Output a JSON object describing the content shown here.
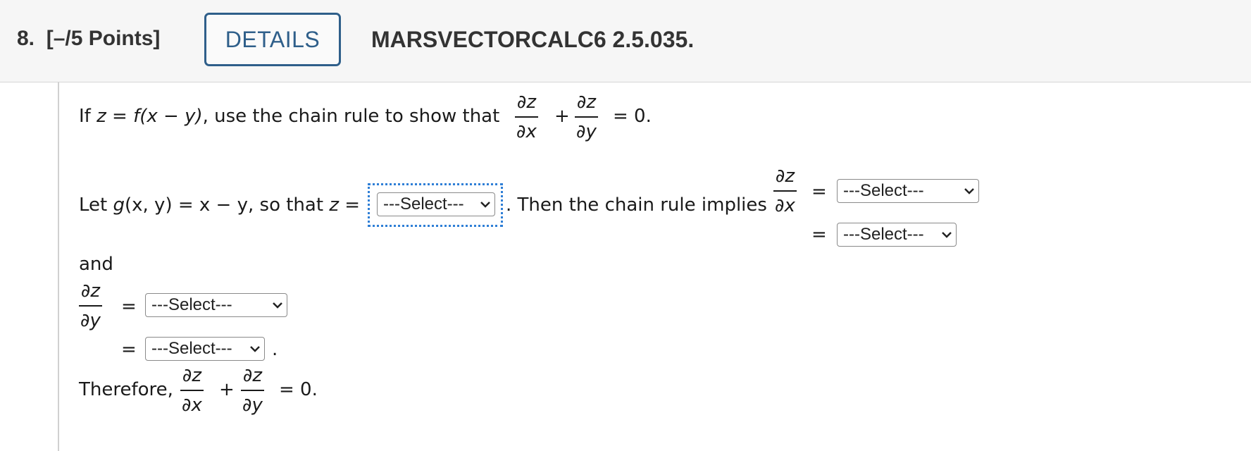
{
  "header": {
    "question_number": "8.",
    "points": "[–/5 Points]",
    "details_label": "DETAILS",
    "problem_id": "MARSVECTORCALC6 2.5.035."
  },
  "statement": {
    "if": "If",
    "z": "z",
    "eq_f": "= ",
    "f_expr": "f(x − y)",
    "rest": ", use the chain rule to show that",
    "dz": "∂z",
    "dx": "∂x",
    "dy": "∂y",
    "plus": "+",
    "eq_zero": "= 0."
  },
  "step1": {
    "let": "Let",
    "g": "g",
    "g_args": "(x, y) = x − y, so that",
    "z_eq": "z =",
    "period": ".",
    "then": "Then the chain rule implies",
    "eq": "="
  },
  "and_label": "and",
  "eq": "=",
  "period": ".",
  "therefore": "Therefore,",
  "select_placeholder": "---Select---"
}
